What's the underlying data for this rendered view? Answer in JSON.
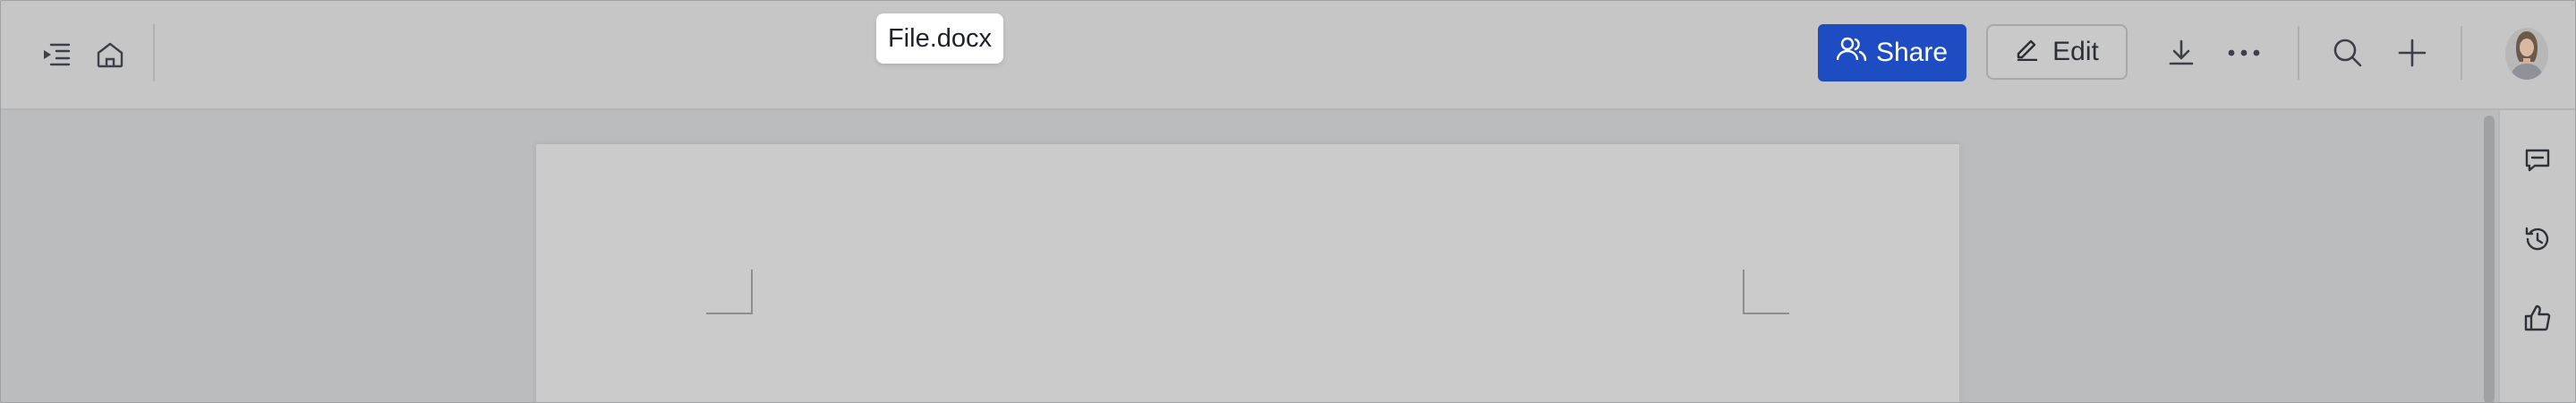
{
  "document": {
    "file_name": "File.docx"
  },
  "toolbar": {
    "share_label": "Share",
    "edit_label": "Edit"
  },
  "icons": {
    "outline": "outline-toggle-icon",
    "home": "home-icon",
    "share": "users-icon",
    "edit": "pencil-icon",
    "download": "download-icon",
    "more": "more-horizontal-icon",
    "search": "search-icon",
    "add": "plus-icon",
    "comment": "comment-icon",
    "history": "history-icon",
    "like": "thumbs-up-icon"
  },
  "colors": {
    "accent": "#1e4cc2",
    "toolbar_bg": "#c6c6c6",
    "canvas_bg": "#bbbcbe",
    "page_bg": "#cbcbcb"
  }
}
